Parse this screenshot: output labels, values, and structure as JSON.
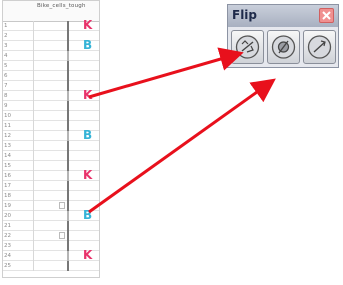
{
  "xsheet": {
    "column_name": "Bike_cells_tough",
    "frames": [
      "1",
      "2",
      "3",
      "4",
      "5",
      "6",
      "7",
      "8",
      "9",
      "10",
      "11",
      "12",
      "13",
      "14",
      "15",
      "16",
      "17",
      "18",
      "19",
      "20",
      "21",
      "22",
      "23",
      "24",
      "25"
    ],
    "keys": [
      {
        "frame": 1,
        "label": "K",
        "color": "#e8336b"
      },
      {
        "frame": 3,
        "label": "B",
        "color": "#35b3d6"
      },
      {
        "frame": 8,
        "label": "K",
        "color": "#e8336b"
      },
      {
        "frame": 12,
        "label": "B",
        "color": "#35b3d6"
      },
      {
        "frame": 16,
        "label": "K",
        "color": "#e8336b"
      },
      {
        "frame": 20,
        "label": "B",
        "color": "#35b3d6"
      },
      {
        "frame": 24,
        "label": "K",
        "color": "#e8336b"
      }
    ]
  },
  "flip_toolbar": {
    "title": "Flip",
    "buttons": [
      {
        "name": "previous-drawing",
        "icon": "flip-previous-icon"
      },
      {
        "name": "play-drawing",
        "icon": "flip-play-icon"
      },
      {
        "name": "next-drawing",
        "icon": "flip-next-icon"
      }
    ]
  },
  "colors": {
    "key_pink": "#e8336b",
    "key_cyan": "#35b3d6",
    "arrow_red": "#e8101c"
  }
}
